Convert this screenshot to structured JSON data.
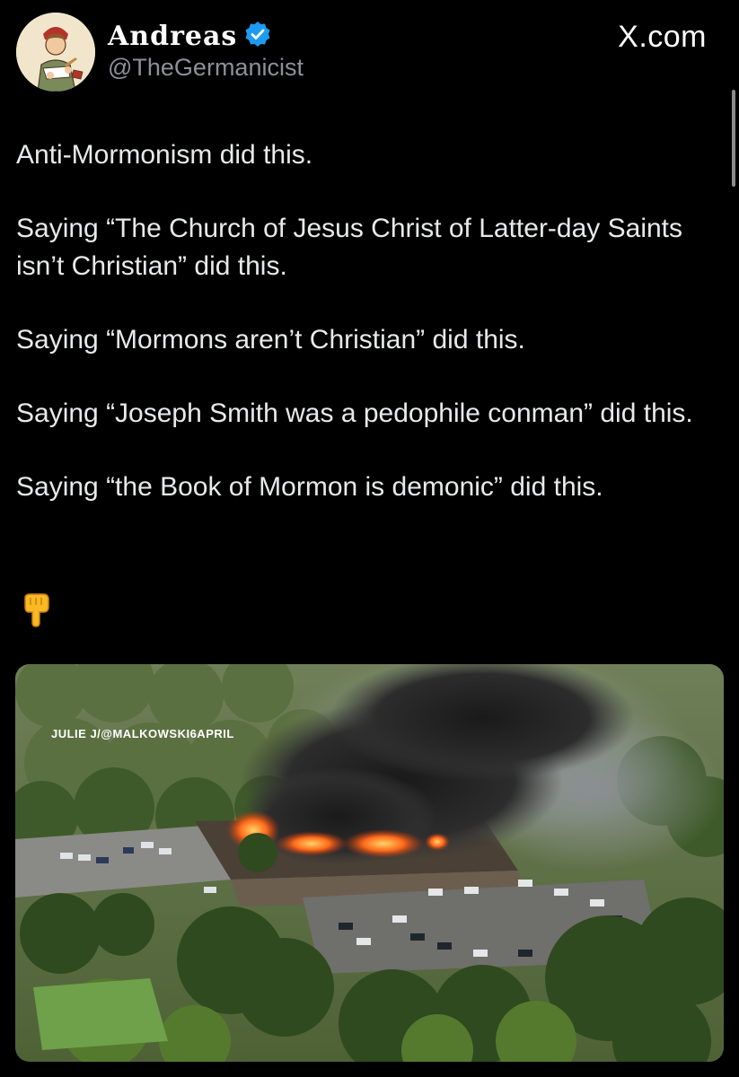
{
  "header": {
    "display_name": "Andreas",
    "handle": "@TheGermanicist",
    "brand": "X.com",
    "verified": true,
    "verified_color": "#1d9bf0",
    "avatar_icon": "medieval-scholar-avatar"
  },
  "tweet": {
    "paragraphs": [
      "Anti-Mormonism did this.",
      "Saying “The Church of Jesus Christ of Latter-day Saints isn’t Christian” did this.",
      "Saying “Mormons aren’t Christian” did this.",
      "Saying “Joseph Smith was a pedophile conman” did this.",
      "Saying “the Book of Mormon is demonic” did this."
    ],
    "emoji": "backhand-index-pointing-down-emoji"
  },
  "media": {
    "watermark": "JULIE J/@MALKOWSKI6APRIL",
    "description_icon": "aerial-building-fire-photo"
  },
  "colors": {
    "background": "#000000",
    "text": "#e7e9ea",
    "secondary_text": "#8b9199"
  }
}
